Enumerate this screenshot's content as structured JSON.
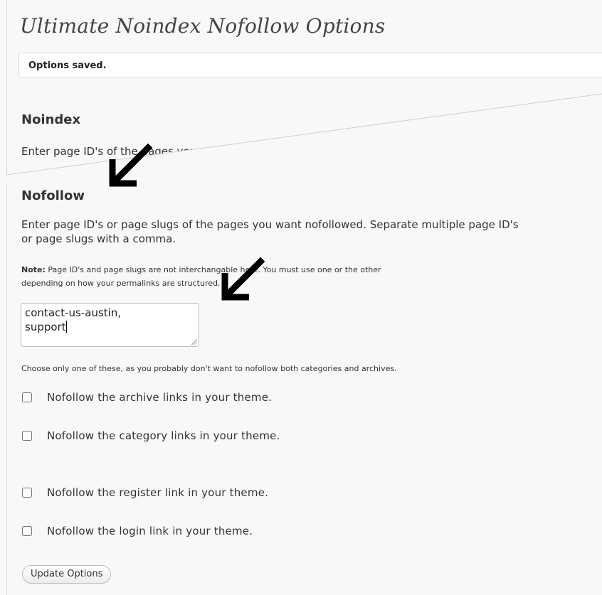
{
  "page": {
    "title": "Ultimate Noindex Nofollow Options",
    "notice": "Options saved."
  },
  "noindex": {
    "heading": "Noindex",
    "description": "Enter page ID's of the pages you want noindexed."
  },
  "nofollow": {
    "heading": "Nofollow",
    "description_line1": "Enter page ID's or page slugs of the pages you want nofollowed. Separate multiple page ID's",
    "description_line2": "or page slugs with a comma.",
    "note_label": "Note:",
    "note_line1": " Page ID's and page slugs are not interchangable here. You must use one or the other",
    "note_line2": "depending on how your permalinks are structured.",
    "textarea_line1": "contact-us-austin,",
    "textarea_line2": "support",
    "choose_note": "Choose only one of these, as you probably don't want to nofollow both categories and archives.",
    "options": [
      {
        "label": "Nofollow the archive links in your theme.",
        "checked": false
      },
      {
        "label": "Nofollow the category links in your theme.",
        "checked": false
      },
      {
        "label": "Nofollow the register link in your theme.",
        "checked": false
      },
      {
        "label": "Nofollow the login link in your theme.",
        "checked": false
      }
    ],
    "submit_label": "Update Options"
  },
  "icons": {
    "annotation": "arrow-down-left-icon"
  }
}
